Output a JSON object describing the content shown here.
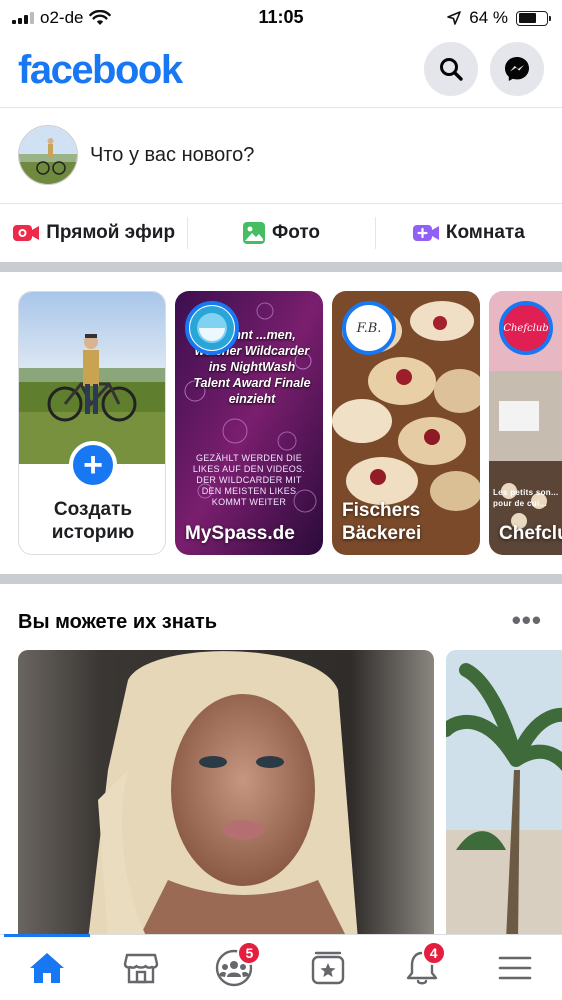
{
  "status_bar": {
    "carrier": "o2-de",
    "time": "11:05",
    "battery": "64 %",
    "battery_level": 0.64,
    "icons": [
      "signal-icon",
      "wifi-icon",
      "location-arrow-icon",
      "battery-icon"
    ]
  },
  "header": {
    "logo": "facebook",
    "brand_color": "#1877f2",
    "buttons": [
      "search-icon",
      "messenger-icon"
    ]
  },
  "composer": {
    "placeholder": "Что у вас нового?"
  },
  "actions": [
    {
      "label": "Прямой эфир",
      "icon": "live-video-icon",
      "color": "#f02849"
    },
    {
      "label": "Фото",
      "icon": "photo-icon",
      "color": "#45bd62"
    },
    {
      "label": "Комната",
      "icon": "room-icon",
      "color": "#9360f7"
    }
  ],
  "stories": {
    "create_label": "Создать историю",
    "items": [
      {
        "name": "MySpass.de",
        "overlay_title": "...könnt ...men, welcher Wildcarder ins NightWash Talent Award Finale einzieht",
        "overlay_sub": "GEZÄHLT WERDEN DIE LIKES AUF DEN VIDEOS. DER WILDCARDER MIT DEN MEISTEN LIKES KOMMT WEITER"
      },
      {
        "name": "Fischers Bäckerei",
        "avatar_text": "F.B."
      },
      {
        "name": "Chefclu",
        "avatar_text": "Chefclub",
        "overlay_text": "Les petits son... pour de cui..."
      }
    ]
  },
  "people_you_may_know": {
    "title": "Вы можете их знать",
    "more": "•••"
  },
  "tabbar": {
    "tabs": [
      {
        "name": "home-icon",
        "active": true
      },
      {
        "name": "marketplace-icon"
      },
      {
        "name": "groups-icon",
        "badge": "5"
      },
      {
        "name": "pages-icon"
      },
      {
        "name": "notifications-icon",
        "badge": "4"
      },
      {
        "name": "menu-icon"
      }
    ],
    "groups_badge": "5",
    "notifications_badge": "4"
  }
}
